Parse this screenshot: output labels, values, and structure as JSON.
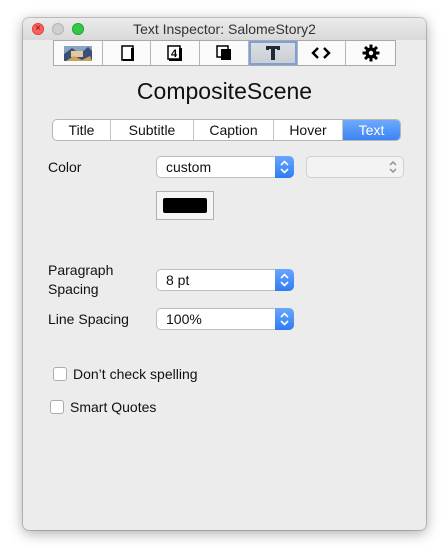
{
  "window": {
    "title": "Text Inspector: SalomeStory2",
    "close_glyph": "×"
  },
  "toolbar": {
    "buttons": [
      {
        "name": "image-tab",
        "icon": "scene-image-icon"
      },
      {
        "name": "page-tab",
        "icon": "blank-page-icon"
      },
      {
        "name": "number-tab",
        "icon": "number-4-icon",
        "glyph": "4"
      },
      {
        "name": "layer-tab",
        "icon": "overlapping-pages-icon"
      },
      {
        "name": "text-tab",
        "icon": "text-t-icon",
        "glyph": "T",
        "active": true
      },
      {
        "name": "code-tab",
        "icon": "code-brackets-icon",
        "glyph": "<>"
      },
      {
        "name": "settings-tab",
        "icon": "gear-icon",
        "glyph": "✱"
      }
    ]
  },
  "heading": "CompositeScene",
  "segments": [
    "Title",
    "Subtitle",
    "Caption",
    "Hover",
    "Text"
  ],
  "selected_segment": "Text",
  "color": {
    "label": "Color",
    "popup_value": "custom",
    "secondary_popup_value": "",
    "swatch": "#000000"
  },
  "paragraph_spacing": {
    "label_line1": "Paragraph",
    "label_line2": "Spacing",
    "value": "8 pt"
  },
  "line_spacing": {
    "label": "Line Spacing",
    "value": "100%"
  },
  "checkboxes": {
    "spelling": {
      "label": "Don’t check spelling",
      "checked": false
    },
    "quotes": {
      "label": "Smart Quotes",
      "checked": false
    }
  },
  "colors": {
    "accent": "#3c84f5",
    "window_bg": "#ececec"
  }
}
